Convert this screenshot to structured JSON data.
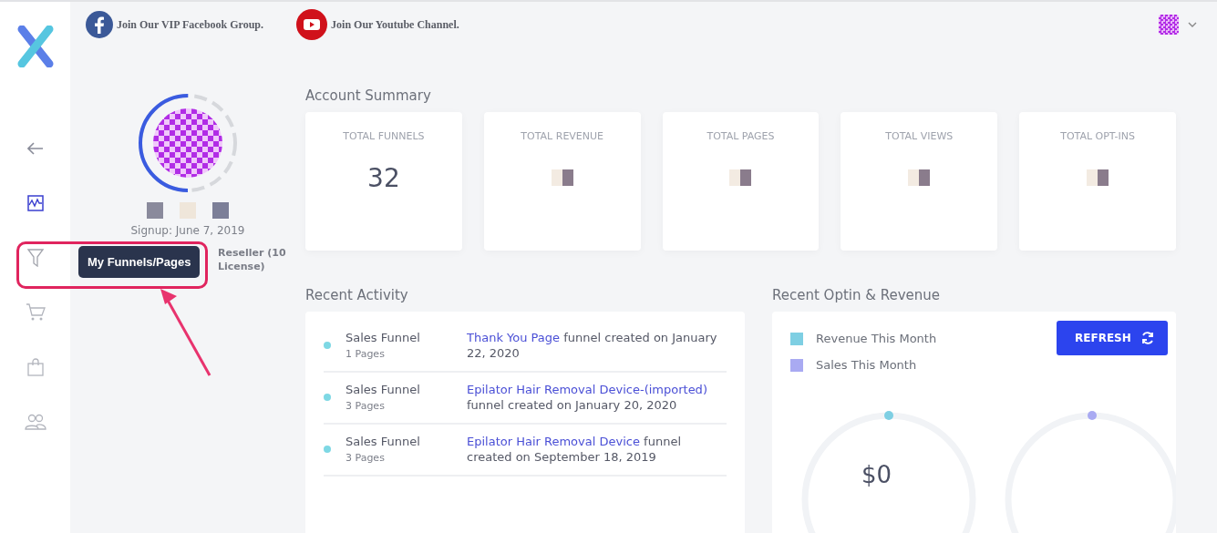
{
  "top_links": [
    {
      "kind": "facebook",
      "label": "Join Our VIP Facebook Group."
    },
    {
      "kind": "youtube",
      "label": "Join Our Youtube Channel."
    }
  ],
  "sidebar": {
    "items": [
      {
        "kind": "back",
        "selected": false
      },
      {
        "kind": "dashboard",
        "selected": true
      },
      {
        "kind": "funnel",
        "selected": false
      },
      {
        "kind": "cart",
        "selected": false
      },
      {
        "kind": "bag",
        "selected": false
      },
      {
        "kind": "users",
        "selected": false
      }
    ],
    "tooltip": "My Funnels/Pages"
  },
  "profile": {
    "signup": "Signup: June 7, 2019",
    "plan": "Reseller (10 License)",
    "level": 0.5
  },
  "account_summary": {
    "title": "Account Summary",
    "cards": [
      {
        "label": "TOTAL FUNNELS",
        "value": "32"
      },
      {
        "label": "TOTAL REVENUE"
      },
      {
        "label": "TOTAL PAGES"
      },
      {
        "label": "TOTAL VIEWS"
      },
      {
        "label": "TOTAL OPT-INS"
      }
    ]
  },
  "recent_activity": {
    "title": "Recent Activity",
    "items": [
      {
        "type": "Sales Funnel",
        "pages": "1 Pages",
        "link": "Thank You Page",
        "text": " funnel created on January 22, 2020"
      },
      {
        "type": "Sales Funnel",
        "pages": "3 Pages",
        "link": "Epilator Hair Removal Device-(imported)",
        "text": " funnel created on January 20, 2020"
      },
      {
        "type": "Sales Funnel",
        "pages": "3 Pages",
        "link": "Epilator Hair Removal Device",
        "text": " funnel created on September 18, 2019"
      }
    ]
  },
  "recent_optin": {
    "title": "Recent Optin & Revenue",
    "legend": [
      {
        "label": "Revenue This Month",
        "color": "#7ecfe3"
      },
      {
        "label": "Sales This Month",
        "color": "#a9aaf2"
      }
    ],
    "button": "REFRESH",
    "gauge_value": "$0"
  }
}
